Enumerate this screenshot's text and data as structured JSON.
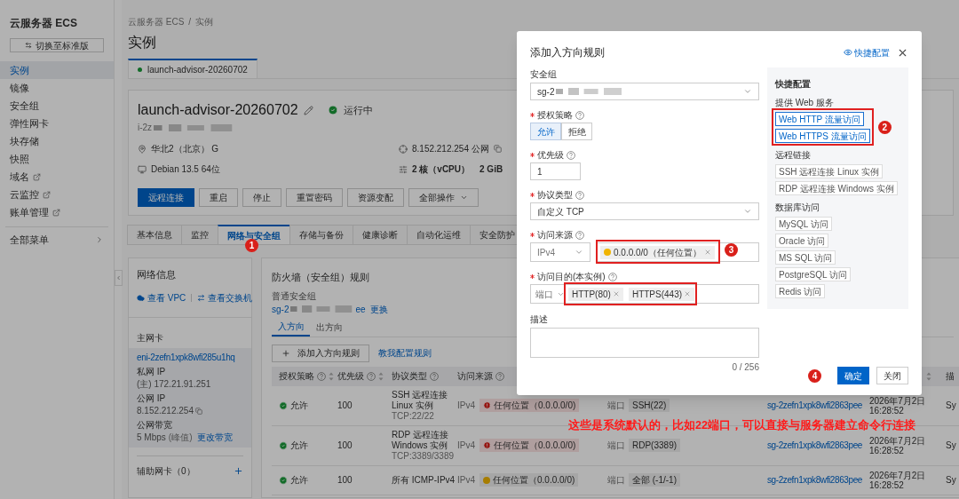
{
  "sidebar": {
    "title": "云服务器 ECS",
    "switch_button": "切换至标准版",
    "items": [
      {
        "label": "实例",
        "selected": true,
        "external": false
      },
      {
        "label": "镜像",
        "selected": false,
        "external": false
      },
      {
        "label": "安全组",
        "selected": false,
        "external": false
      },
      {
        "label": "弹性网卡",
        "selected": false,
        "external": false
      },
      {
        "label": "块存储",
        "selected": false,
        "external": false
      },
      {
        "label": "快照",
        "selected": false,
        "external": false
      },
      {
        "label": "域名",
        "selected": false,
        "external": true
      },
      {
        "label": "云监控",
        "selected": false,
        "external": true
      },
      {
        "label": "账单管理",
        "selected": false,
        "external": true
      }
    ],
    "footer": "全部菜单"
  },
  "breadcrumb": [
    "云服务器 ECS",
    "/",
    "实例"
  ],
  "page_title": "实例",
  "instance_tabs": [
    {
      "label": "launch-advisor-20260702",
      "selected": true
    }
  ],
  "instance": {
    "name": "launch-advisor-20260702",
    "status": "运行中",
    "id": "i-2z",
    "region": "华北2（北京） G",
    "os": "Debian 13.5 64位",
    "ip": "8.152.212.254 公网",
    "cpu": "2 核（vCPU）",
    "memory": "2 GiB",
    "actions": [
      {
        "label": "远程连接",
        "primary": true,
        "dropdown": false
      },
      {
        "label": "重启",
        "primary": false,
        "dropdown": false
      },
      {
        "label": "停止",
        "primary": false,
        "dropdown": false
      },
      {
        "label": "重置密码",
        "primary": false,
        "dropdown": false
      },
      {
        "label": "资源变配",
        "primary": false,
        "dropdown": false
      },
      {
        "label": "全部操作",
        "primary": false,
        "dropdown": true
      }
    ]
  },
  "detail_tabs": [
    {
      "label": "基本信息",
      "selected": false
    },
    {
      "label": "监控",
      "selected": false
    },
    {
      "label": "网络与安全组",
      "selected": true
    },
    {
      "label": "存储与备份",
      "selected": false
    },
    {
      "label": "健康诊断",
      "selected": false
    },
    {
      "label": "自动化运维",
      "selected": false
    },
    {
      "label": "安全防护",
      "selected": false
    }
  ],
  "network": {
    "title": "网络信息",
    "vpc_link": "查看 VPC",
    "switch_link": "查看交换机",
    "primary_nic": "主网卡",
    "nic_id": "eni-2zefn1xpk8wfi285u1hq",
    "private_ip_label": "私网 IP",
    "private_ip": "(主) 172.21.91.251",
    "public_ip_label": "公网 IP",
    "public_ip": "8.152.212.254",
    "bandwidth_label": "公网带宽",
    "bandwidth": "5 Mbps",
    "bandwidth_note": "(峰值)",
    "bandwidth_link": "更改带宽",
    "secondary_nic": "辅助网卡（0）"
  },
  "firewall": {
    "title": "防火墙（安全组）规则",
    "group_type": "普通安全组",
    "group_prefix": "sg-2",
    "group_suffix": "ee",
    "change_link": "更换",
    "tabs": [
      {
        "label": "入方向",
        "selected": true
      },
      {
        "label": "出方向",
        "selected": false
      }
    ],
    "add_button": "添加入方向规则",
    "help_link": "教我配置规则",
    "columns": [
      {
        "label": "授权策略",
        "help": true,
        "sortable": true
      },
      {
        "label": "优先级",
        "help": true,
        "sortable": true
      },
      {
        "label": "协议类型",
        "help": true,
        "sortable": false
      },
      {
        "label": "访问来源",
        "help": true,
        "sortable": false
      }
    ],
    "column_7_sortable": true,
    "column_8": "描",
    "rows": [
      {
        "policy": "允许",
        "priority": "100",
        "protocol": "SSH 远程连接",
        "protocol_sub": "Linux 实例",
        "protocol_detail": "TCP:22/22",
        "ip": "IPv4",
        "source": {
          "text": "任何位置（0.0.0.0/0)",
          "kind": "danger"
        },
        "dest_label": "端口",
        "dest": "SSH(22)",
        "group": "sg-2zefn1xpk8wfi2863pee",
        "date": "2026年7月2日",
        "time": "16:28:52",
        "column_8": "Sy"
      },
      {
        "policy": "允许",
        "priority": "100",
        "protocol": "RDP 远程连接",
        "protocol_sub": "Windows 实例",
        "protocol_detail": "TCP:3389/3389",
        "ip": "IPv4",
        "source": {
          "text": "任何位置（0.0.0.0/0)",
          "kind": "danger"
        },
        "dest_label": "端口",
        "dest": "RDP(3389)",
        "group": "sg-2zefn1xpk8wfi2863pee",
        "date": "2026年7月2日",
        "time": "16:28:52",
        "column_8": "Sy"
      },
      {
        "policy": "允许",
        "priority": "100",
        "protocol": "所有 ICMP-IPv4",
        "ip": "IPv4",
        "source": {
          "text": "任何位置（0.0.0.0/0)",
          "kind": "warning"
        },
        "dest_label": "端口",
        "dest": "全部 (-1/-1)",
        "group": "sg-2zefn1xpk8wfi2863pee",
        "date": "2026年7月2日",
        "time": "16:28:52",
        "column_8": "Sy"
      }
    ]
  },
  "modal": {
    "title": "添加入方向规则",
    "quick_link": "快捷配置",
    "security_group": {
      "label": "安全组",
      "value": "sg-2"
    },
    "policy": {
      "label": "授权策略",
      "required": true,
      "options": [
        {
          "label": "允许",
          "selected": true
        },
        {
          "label": "拒绝",
          "selected": false
        }
      ]
    },
    "priority": {
      "label": "优先级",
      "required": true,
      "value": "1"
    },
    "protocol": {
      "label": "协议类型",
      "required": true,
      "value": "自定义 TCP"
    },
    "source": {
      "label": "访问来源",
      "required": true,
      "ip_version": "IPv4",
      "tags": [
        {
          "text": "0.0.0.0/0（任何位置）",
          "kind": "warning"
        }
      ]
    },
    "destination": {
      "label": "访问目的(本实例)",
      "required": true,
      "type": "端口",
      "tags": [
        "HTTP(80)",
        "HTTPS(443)"
      ]
    },
    "description": {
      "label": "描述",
      "counter": "0 / 256"
    },
    "confirm": "确定",
    "close": "关闭",
    "quick": {
      "title": "快捷配置",
      "groups": [
        {
          "title": "提供 Web 服务",
          "items": [
            {
              "label": "Web HTTP 流量访问",
              "highlighted": true
            },
            {
              "label": "Web HTTPS 流量访问",
              "highlighted": true
            }
          ]
        },
        {
          "title": "远程链接",
          "items": [
            {
              "label": "SSH 远程连接 Linux 实例",
              "highlighted": false
            },
            {
              "label": "RDP 远程连接 Windows 实例",
              "highlighted": false
            }
          ]
        },
        {
          "title": "数据库访问",
          "items": [
            {
              "label": "MySQL 访问",
              "highlighted": false
            },
            {
              "label": "Oracle 访问",
              "highlighted": false
            },
            {
              "label": "MS SQL 访问",
              "highlighted": false
            },
            {
              "label": "PostgreSQL 访问",
              "highlighted": false
            },
            {
              "label": "Redis 访问",
              "highlighted": false
            }
          ]
        }
      ]
    }
  },
  "annotations": {
    "tab_badge": "1",
    "quick_badge": "2",
    "source_badge": "3",
    "confirm_badge": "4",
    "note": "这些是系统默认的，比如22端口，可以直接与服务器建立命令行连接"
  }
}
